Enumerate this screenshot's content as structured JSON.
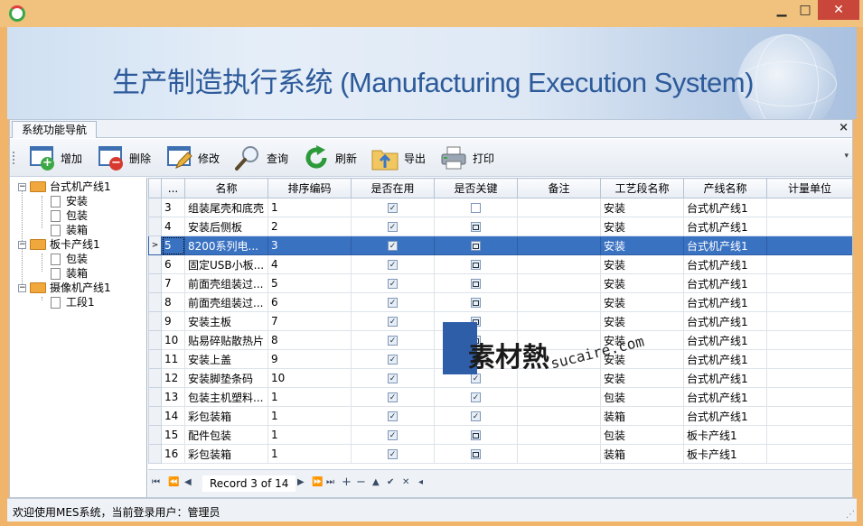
{
  "window": {
    "min_glyph": "▁",
    "max_glyph": "□",
    "close_glyph": "✕"
  },
  "banner": {
    "title": "生产制造执行系统 (Manufacturing Execution System)"
  },
  "panel": {
    "tab_label": "系统功能导航",
    "close_glyph": "×"
  },
  "toolbar": {
    "buttons": [
      {
        "label": "增加",
        "icon": "add-icon"
      },
      {
        "label": "删除",
        "icon": "delete-icon"
      },
      {
        "label": "修改",
        "icon": "edit-icon"
      },
      {
        "label": "查询",
        "icon": "search-icon"
      },
      {
        "label": "刷新",
        "icon": "refresh-icon"
      },
      {
        "label": "导出",
        "icon": "export-folder-icon"
      },
      {
        "label": "打印",
        "icon": "printer-icon"
      }
    ]
  },
  "tree": {
    "nodes": [
      {
        "label": "台式机产线1",
        "level": 0
      },
      {
        "label": "安装",
        "level": 1
      },
      {
        "label": "包装",
        "level": 1
      },
      {
        "label": "装箱",
        "level": 1
      },
      {
        "label": "板卡产线1",
        "level": 0
      },
      {
        "label": "包装",
        "level": 1
      },
      {
        "label": "装箱",
        "level": 1
      },
      {
        "label": "摄像机产线1",
        "level": 0
      },
      {
        "label": "工段1",
        "level": 1
      }
    ]
  },
  "grid": {
    "columns": [
      "...",
      "名称",
      "排序编码",
      "是否在用",
      "是否关键",
      "备注",
      "工艺段名称",
      "产线名称",
      "计量单位"
    ],
    "rows": [
      {
        "id": "3",
        "name": "组装尾壳和底壳",
        "order": "1",
        "active": "checked",
        "key": "empty",
        "remark": "",
        "stage": "安装",
        "line": "台式机产线1",
        "unit": ""
      },
      {
        "id": "4",
        "name": "安装后侧板",
        "order": "2",
        "active": "checked",
        "key": "partial",
        "remark": "",
        "stage": "安装",
        "line": "台式机产线1",
        "unit": ""
      },
      {
        "id": "5",
        "name": "8200系列电...",
        "order": "3",
        "active": "checked",
        "key": "partial",
        "remark": "",
        "stage": "安装",
        "line": "台式机产线1",
        "unit": "",
        "selected": true
      },
      {
        "id": "6",
        "name": "固定USB小板...",
        "order": "4",
        "active": "checked",
        "key": "partial",
        "remark": "",
        "stage": "安装",
        "line": "台式机产线1",
        "unit": ""
      },
      {
        "id": "7",
        "name": "前面壳组装过...",
        "order": "5",
        "active": "checked",
        "key": "partial",
        "remark": "",
        "stage": "安装",
        "line": "台式机产线1",
        "unit": ""
      },
      {
        "id": "8",
        "name": "前面壳组装过...",
        "order": "6",
        "active": "checked",
        "key": "partial",
        "remark": "",
        "stage": "安装",
        "line": "台式机产线1",
        "unit": ""
      },
      {
        "id": "9",
        "name": "安装主板",
        "order": "7",
        "active": "checked",
        "key": "partial",
        "remark": "",
        "stage": "安装",
        "line": "台式机产线1",
        "unit": ""
      },
      {
        "id": "10",
        "name": "贴易碎贴散热片",
        "order": "8",
        "active": "checked",
        "key": "partial",
        "remark": "",
        "stage": "安装",
        "line": "台式机产线1",
        "unit": ""
      },
      {
        "id": "11",
        "name": "安装上盖",
        "order": "9",
        "active": "checked",
        "key": "partial",
        "remark": "",
        "stage": "安装",
        "line": "台式机产线1",
        "unit": ""
      },
      {
        "id": "12",
        "name": "安装脚垫条码",
        "order": "10",
        "active": "checked",
        "key": "checked",
        "remark": "",
        "stage": "安装",
        "line": "台式机产线1",
        "unit": ""
      },
      {
        "id": "13",
        "name": "包装主机塑料...",
        "order": "1",
        "active": "checked",
        "key": "checked",
        "remark": "",
        "stage": "包装",
        "line": "台式机产线1",
        "unit": ""
      },
      {
        "id": "14",
        "name": "彩包装箱",
        "order": "1",
        "active": "checked",
        "key": "checked",
        "remark": "",
        "stage": "装箱",
        "line": "台式机产线1",
        "unit": ""
      },
      {
        "id": "15",
        "name": "配件包装",
        "order": "1",
        "active": "checked",
        "key": "partial",
        "remark": "",
        "stage": "包装",
        "line": "板卡产线1",
        "unit": ""
      },
      {
        "id": "16",
        "name": "彩包装箱",
        "order": "1",
        "active": "checked",
        "key": "partial",
        "remark": "",
        "stage": "装箱",
        "line": "板卡产线1",
        "unit": ""
      }
    ],
    "selected_indicator": ">"
  },
  "navigator": {
    "record_text": "Record 3 of 14",
    "first": "⏮",
    "prev_page": "⏪",
    "prev": "◀",
    "next": "▶",
    "next_page": "⏩",
    "last": "⏭",
    "add": "+",
    "remove": "−",
    "up": "▲",
    "ok": "✔",
    "cancel": "✕",
    "more": "◂"
  },
  "status": {
    "text": "欢迎使用MES系统，当前登录用户：管理员"
  },
  "watermark": {
    "brand": "素材熱",
    "url": "sucaire.com"
  }
}
